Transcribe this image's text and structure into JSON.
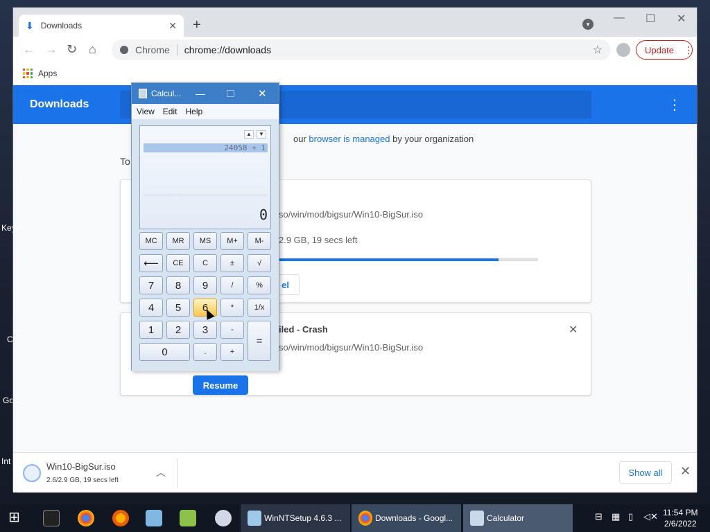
{
  "desktop": {
    "labels": [
      "Key",
      "C",
      "Go",
      "Int"
    ]
  },
  "chrome": {
    "tab_title": "Downloads",
    "site_label": "Chrome",
    "url": "chrome://downloads",
    "bookmarks_apps": "Apps",
    "update_label": "Update",
    "header_title": "Downloads",
    "managed_prefix": "our",
    "managed_link": "browser is managed",
    "managed_suffix": "by your organization",
    "today_label": "To",
    "item1": {
      "path": "so/win/mod/bigsur/Win10-BigSur.iso",
      "status": "2.9 GB, 19 secs left",
      "progress": 0.85,
      "cancel_label": "el"
    },
    "item2": {
      "status_title": "iled - Crash",
      "path": "so/win/mod/bigsur/Win10-BigSur.iso",
      "resume_label": "Resume"
    },
    "shelf": {
      "file_name": "Win10-BigSur.iso",
      "file_status": "2.6/2.9 GB, 19 secs left",
      "show_all": "Show all"
    },
    "colors": {
      "accent": "#1a73e8",
      "update": "#c5221f"
    }
  },
  "calculator": {
    "title": "Calcul...",
    "menu": [
      "View",
      "Edit",
      "Help"
    ],
    "history": "24058 + 1",
    "display_value": "0",
    "buttons": {
      "mc": "MC",
      "mr": "MR",
      "ms": "MS",
      "mplus": "M+",
      "mminus": "M-",
      "back": "⟵",
      "ce": "CE",
      "c": "C",
      "pm": "±",
      "sqrt": "√",
      "n7": "7",
      "n8": "8",
      "n9": "9",
      "div": "/",
      "pct": "%",
      "n4": "4",
      "n5": "5",
      "n6": "6",
      "mul": "*",
      "recip": "1/x",
      "n1": "1",
      "n2": "2",
      "n3": "3",
      "sub": "-",
      "eq": "=",
      "n0": "0",
      "dot": ".",
      "add": "+"
    }
  },
  "taskbar": {
    "items": [
      "WinNTSetup 4.6.3 ...",
      "Downloads - Googl...",
      "Calculator"
    ],
    "time": "11:54 PM",
    "date": "2/6/2022"
  }
}
